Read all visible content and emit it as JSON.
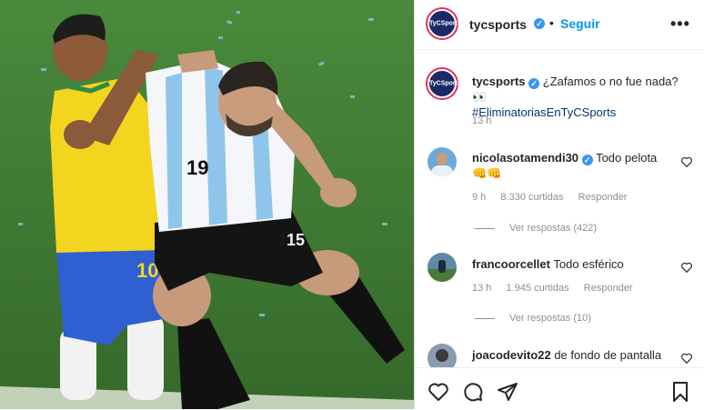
{
  "post": {
    "account": "tycsports",
    "brand_initials": "TyCSports",
    "follow_label": "Seguir",
    "dot": "•",
    "more": "•••",
    "caption_user": "tycsports",
    "caption_text": "¿Zafamos o no fue nada? 👀",
    "caption_hashtag": "#EliminatoriasEnTyCSports",
    "caption_time": "13 h"
  },
  "comments": [
    {
      "user": "nicolasotamendi30",
      "text": "Todo pelota",
      "text2": "👊👊",
      "time": "9 h",
      "likes": "8.330 curtidas",
      "reply": "Responder",
      "replies": "Ver respostas (422)"
    },
    {
      "user": "francoorcellet",
      "text": "Todo esférico",
      "time": "13 h",
      "likes": "1.945 curtidas",
      "reply": "Responder",
      "replies": "Ver respostas (10)"
    },
    {
      "user": "joacodevito22",
      "text": "de fondo de pantalla"
    }
  ],
  "photo": {
    "jersey_number_argentina": "19",
    "jersey_number_shorts": "15",
    "jersey_number_brazil": "10"
  },
  "colors": {
    "accent": "#0095f6",
    "verified": "#3897f0",
    "brand": "#1b2a66",
    "pitch": "#3f7a35"
  },
  "icons": [
    "heart-icon",
    "comment-icon",
    "share-icon",
    "bookmark-icon",
    "verified-icon",
    "more-icon"
  ]
}
